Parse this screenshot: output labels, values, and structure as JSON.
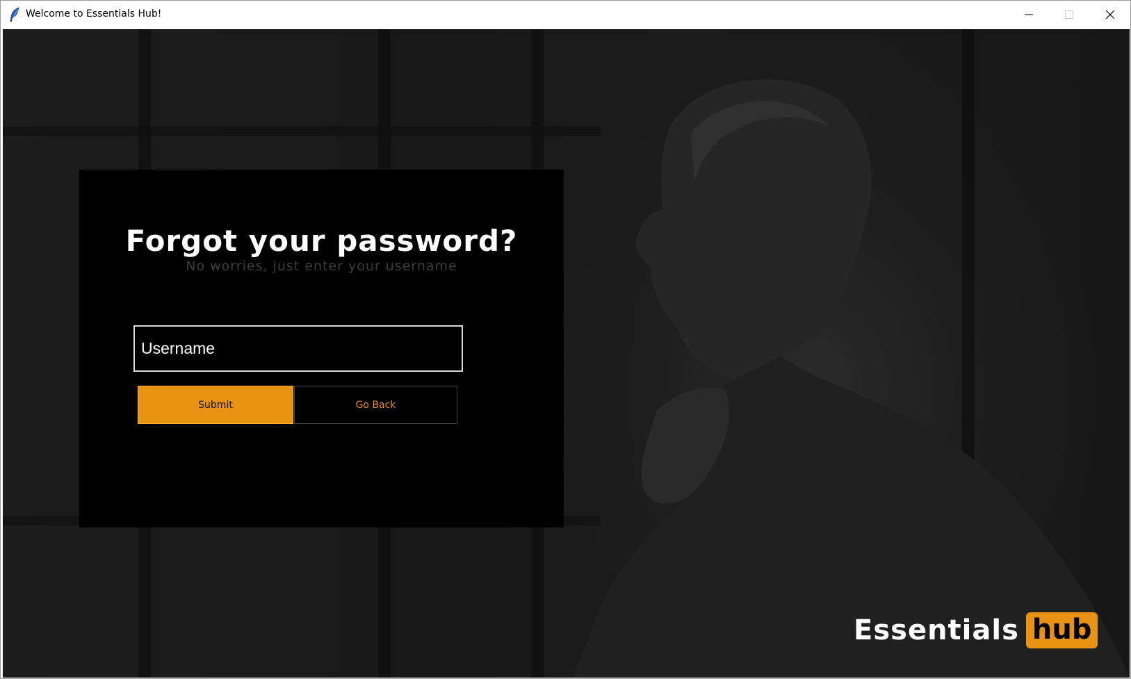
{
  "window": {
    "title": "Welcome to Essentials Hub!",
    "app_icon": "feather-icon",
    "controls": {
      "minimize_icon": "minimize-icon",
      "maximize_icon": "maximize-icon",
      "close_icon": "close-icon"
    }
  },
  "form": {
    "heading": "Forgot your password?",
    "subheading": "No worries, just enter your username",
    "username_placeholder": "Username",
    "username_value": "",
    "submit_label": "Submit",
    "go_back_label": "Go Back"
  },
  "brand": {
    "word": "Essentials",
    "badge": "hub"
  },
  "colors": {
    "accent": "#e89213",
    "panel_background": "#000000",
    "input_border": "#d9d9d9",
    "subheading_text": "#3c3c3c",
    "secondary_button_border": "#4a4a4a"
  }
}
